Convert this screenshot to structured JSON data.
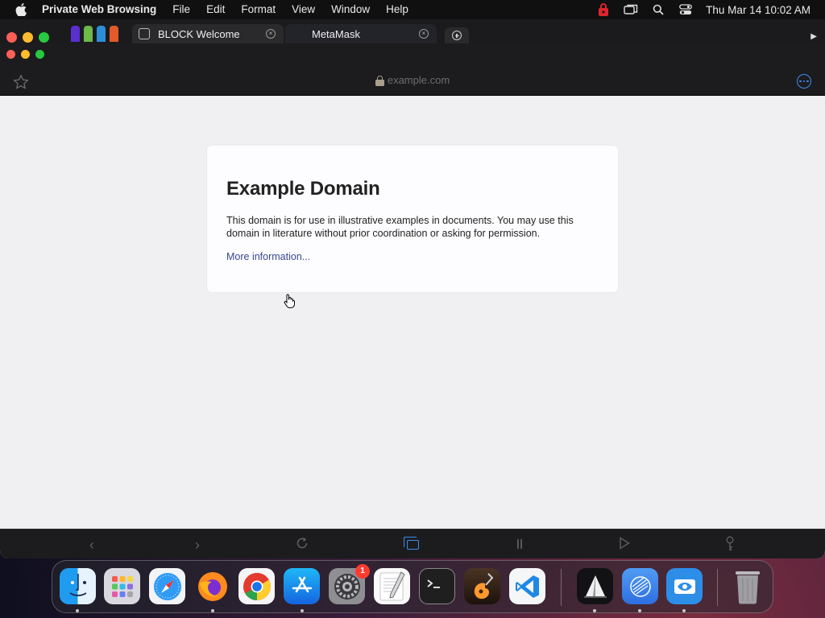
{
  "menubar": {
    "app_name": "Private Web Browsing",
    "items": [
      "File",
      "Edit",
      "Format",
      "View",
      "Window",
      "Help"
    ],
    "clock": "Thu Mar 14  10:02 AM"
  },
  "tabs": [
    {
      "title": "BLOCK Welcome"
    },
    {
      "title": "MetaMask"
    }
  ],
  "address_bar": {
    "url": "example.com"
  },
  "page": {
    "heading": "Example Domain",
    "paragraph": "This domain is for use in illustrative examples in documents. You may use this domain in literature without prior coordination or asking for permission.",
    "link": "More information..."
  },
  "dock": {
    "settings_badge": "1"
  },
  "colors": {
    "accent": "#3d8cf0",
    "link": "#38488f",
    "badge": "#ff3b30"
  }
}
